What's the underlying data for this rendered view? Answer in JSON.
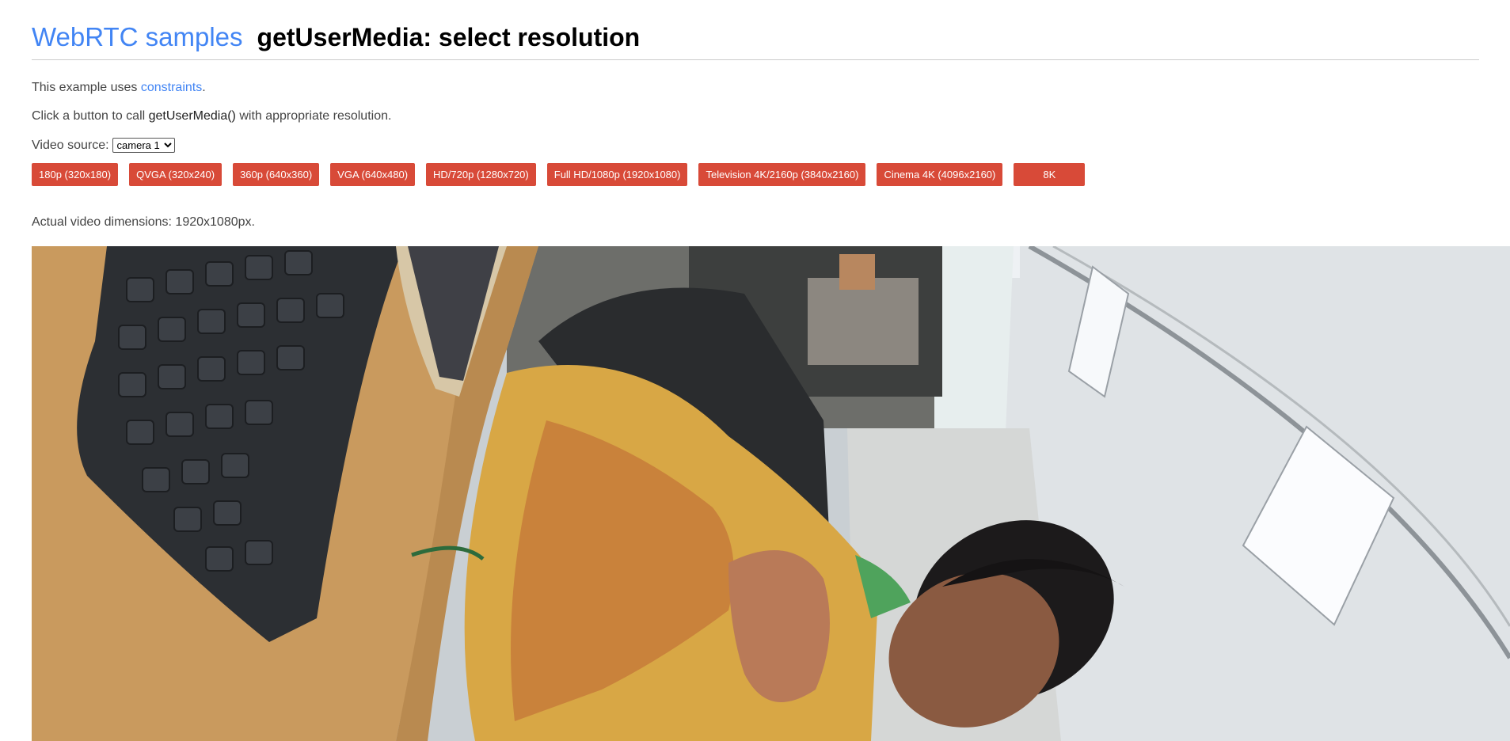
{
  "header": {
    "site_link": "WebRTC samples",
    "title": "getUserMedia: select resolution"
  },
  "intro": {
    "prefix": "This example uses ",
    "link": "constraints",
    "suffix": "."
  },
  "instructions": {
    "prefix": "Click a button to call ",
    "code": "getUserMedia()",
    "suffix": " with appropriate resolution."
  },
  "video_source": {
    "label": "Video source:",
    "selected": "camera 1"
  },
  "resolution_buttons": [
    "180p (320x180)",
    "QVGA (320x240)",
    "360p (640x360)",
    "VGA (640x480)",
    "HD/720p (1280x720)",
    "Full HD/1080p (1920x1080)",
    "Television 4K/2160p (3840x2160)",
    "Cinema 4K (4096x2160)",
    "8K"
  ],
  "status": {
    "dimensions": "Actual video dimensions: 1920x1080px."
  },
  "colors": {
    "accent_link": "#4285f4",
    "button_bg": "#d84a38"
  }
}
